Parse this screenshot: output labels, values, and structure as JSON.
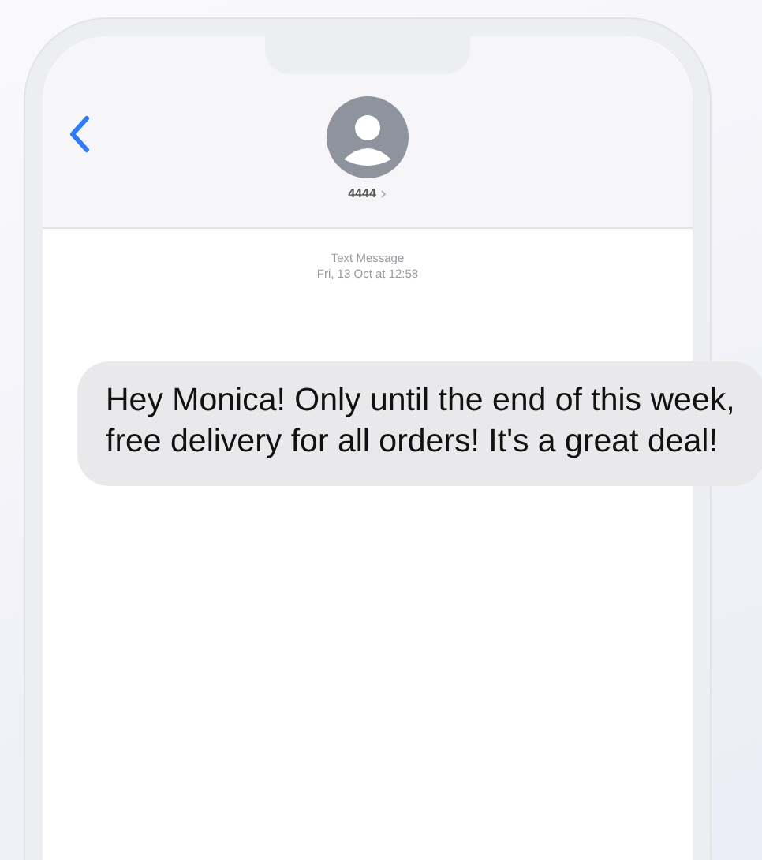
{
  "contact": {
    "name": "4444"
  },
  "thread": {
    "service": "Text Message",
    "timestamp": "Fri, 13 Oct at 12:58"
  },
  "messages": [
    {
      "kind": "incoming",
      "text": "Hey Monica! Only until the end of this week, free delivery for all orders! It's a great deal!"
    }
  ]
}
